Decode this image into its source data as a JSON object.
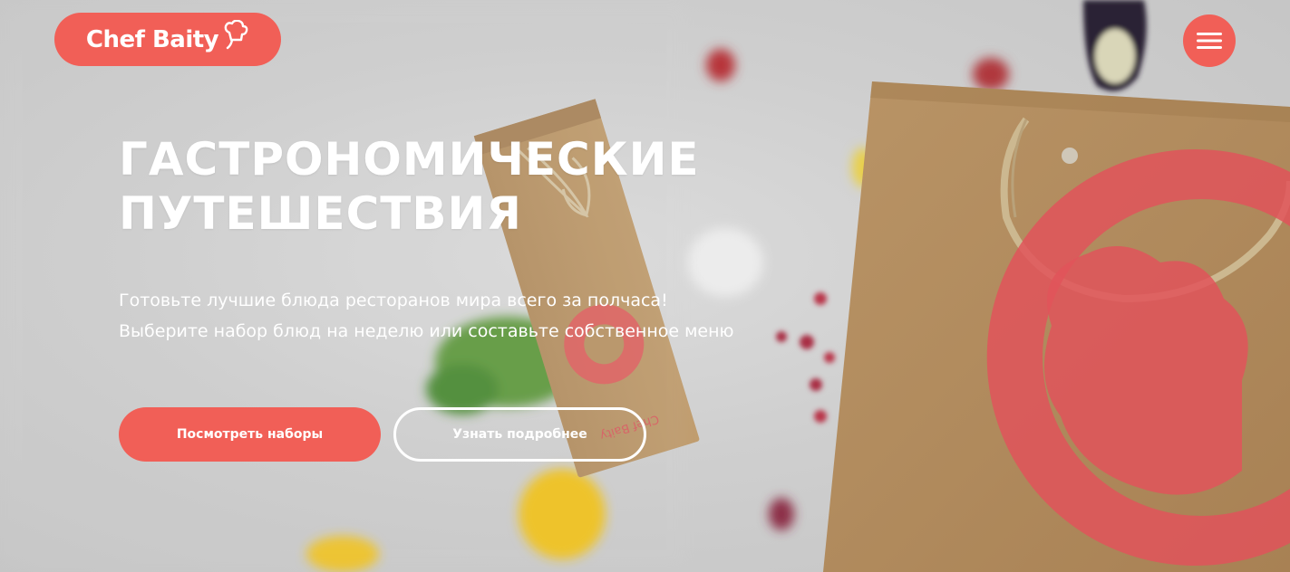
{
  "header": {
    "logo_text": "Chef Baity",
    "menu_icon": "hamburger-menu-icon"
  },
  "hero": {
    "title_line1": "ГАСТРОНОМИЧЕСКИЕ",
    "title_line2": "ПУТЕШЕСТВИЯ",
    "subtitle_line1": "Готовьте лучшие блюда ресторанов мира всего за полчаса!",
    "subtitle_line2": "Выберите набор блюд на неделю или составьте собственное меню",
    "primary_button_label": "Посмотреть наборы",
    "secondary_button_label": "Узнать подробнее"
  },
  "colors": {
    "accent": "#f15f57",
    "text_light": "#ffffff",
    "background": "#cfcfcf",
    "kraft": "#b08a5c"
  }
}
